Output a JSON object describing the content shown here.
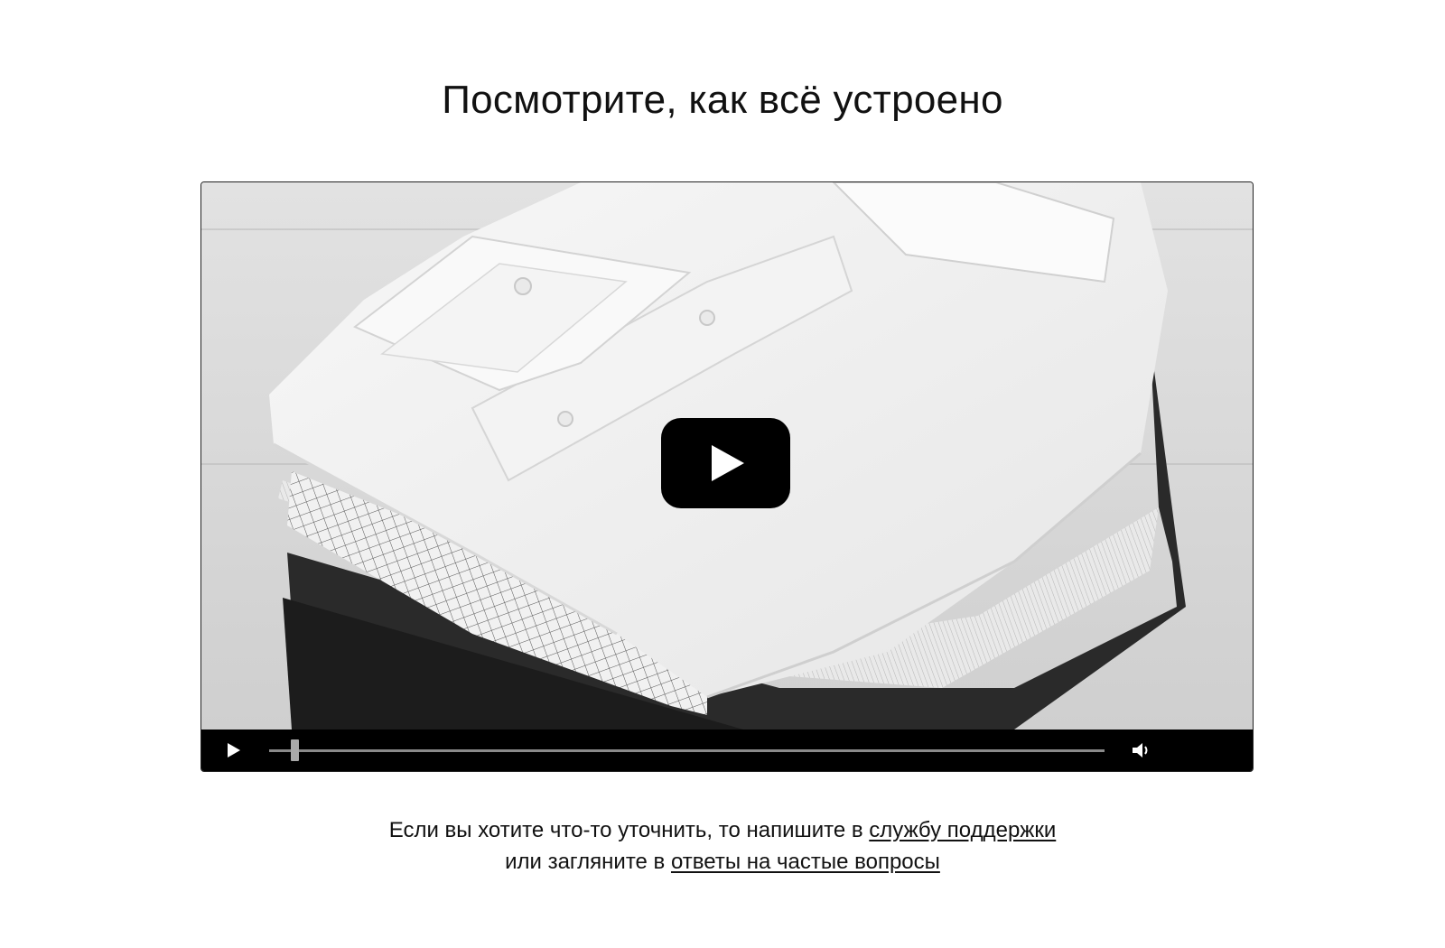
{
  "page": {
    "title": "Посмотрите, как всё устроено"
  },
  "video": {
    "poster_description_icon": "folded-shirts-photo",
    "play_overlay_icon": "play-icon",
    "controls": {
      "play_icon": "play-icon",
      "volume_icon": "volume-icon",
      "progress_fraction": 0.03
    }
  },
  "footer": {
    "line1_prefix": "Если вы хотите что-то уточнить, то напишите в ",
    "support_link": "службу поддержки",
    "line2_prefix": "или загляните в ",
    "faq_link": "ответы на частые вопросы"
  },
  "colors": {
    "background": "#ffffff",
    "text": "#111111",
    "controls_bg": "#000000",
    "overlay_button": "#000000"
  }
}
